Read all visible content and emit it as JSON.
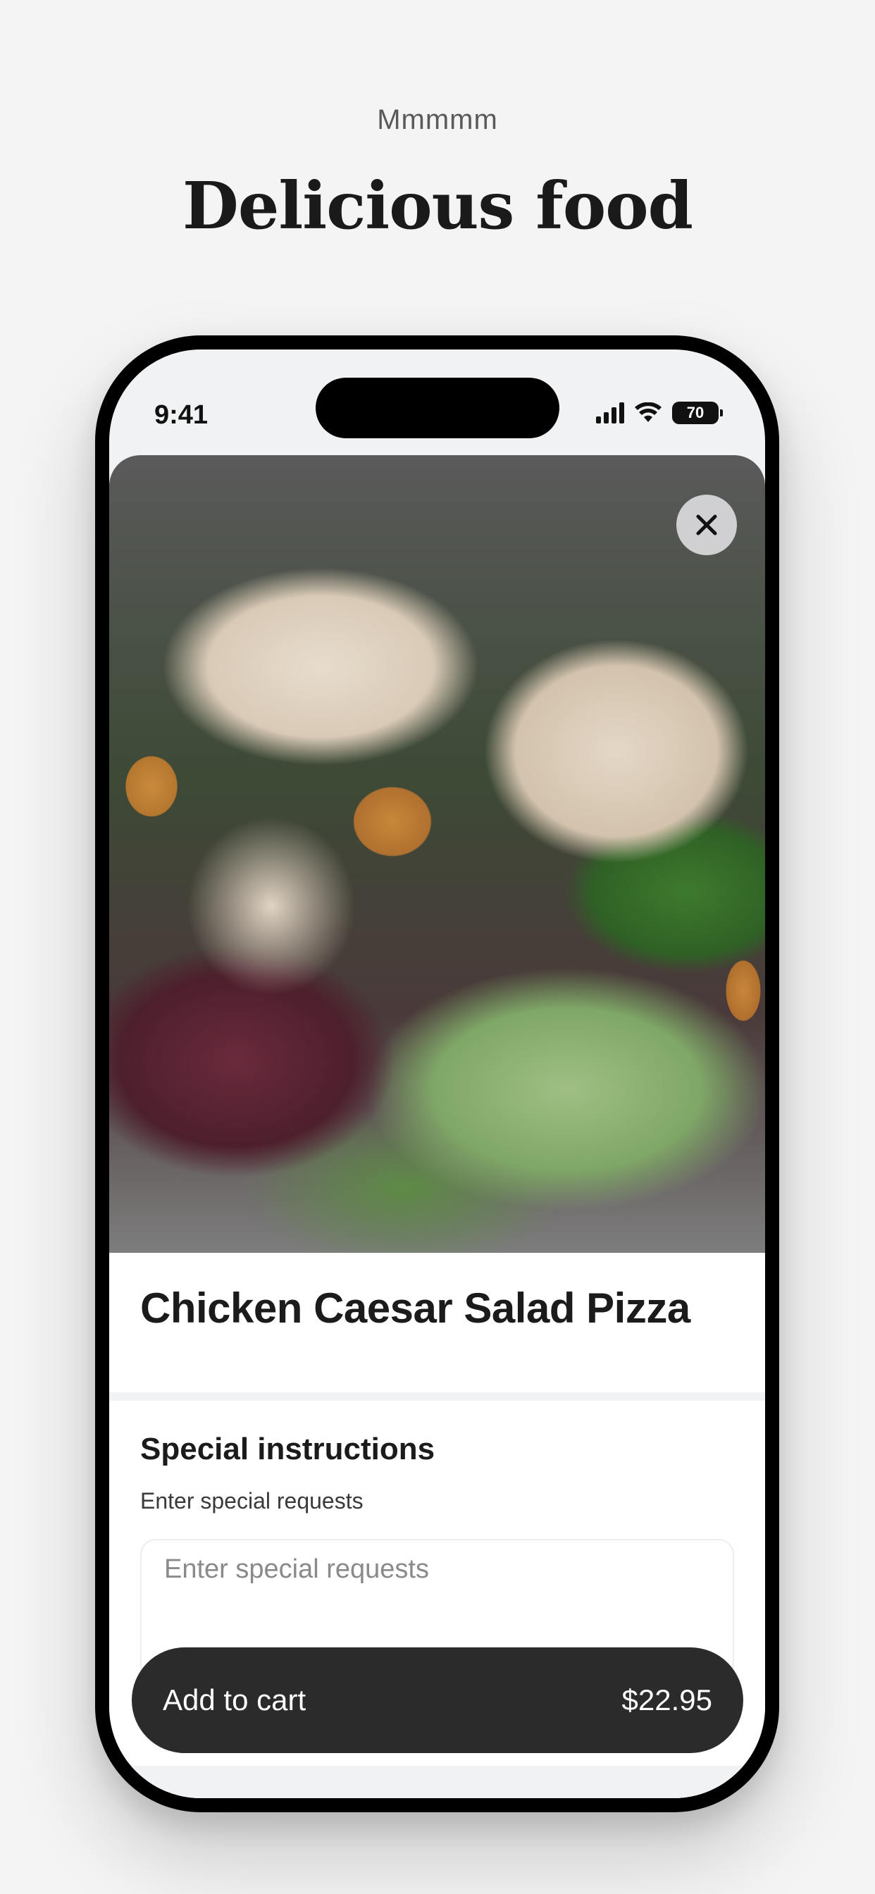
{
  "header": {
    "kicker": "Mmmmm",
    "headline": "Delicious food"
  },
  "status_bar": {
    "time": "9:41",
    "battery": "70"
  },
  "item": {
    "title": "Chicken Caesar Salad Pizza",
    "close_icon": "close-icon"
  },
  "special_instructions": {
    "title": "Special instructions",
    "subtitle": "Enter special requests",
    "placeholder": "Enter special requests"
  },
  "cart": {
    "label": "Add to cart",
    "price": "$22.95"
  }
}
